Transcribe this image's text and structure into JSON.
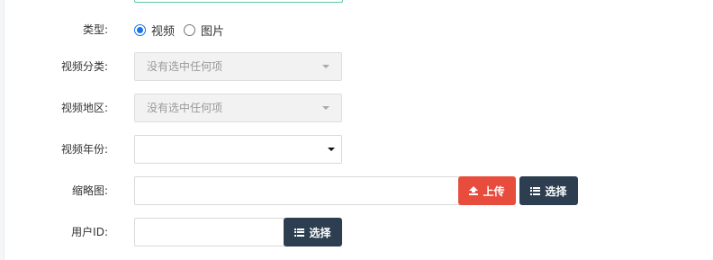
{
  "form": {
    "type": {
      "label": "类型:",
      "options": [
        {
          "label": "视频",
          "checked": true
        },
        {
          "label": "图片",
          "checked": false
        }
      ]
    },
    "video_category": {
      "label": "视频分类:",
      "placeholder": "没有选中任何项",
      "disabled": true
    },
    "video_region": {
      "label": "视频地区:",
      "placeholder": "没有选中任何项",
      "disabled": true
    },
    "video_year": {
      "label": "视频年份:",
      "value": ""
    },
    "thumbnail": {
      "label": "缩略图:",
      "value": "",
      "upload_label": "上传",
      "select_label": "选择"
    },
    "user_id": {
      "label": "用户ID:",
      "value": "",
      "select_label": "选择"
    }
  },
  "colors": {
    "upload_button": "#e74c3c",
    "select_button": "#2c3e50",
    "radio_checked": "#1a73e8"
  },
  "icons": {
    "upload": "upload-icon",
    "select": "list-icon",
    "dropdown": "caret-down-icon"
  }
}
